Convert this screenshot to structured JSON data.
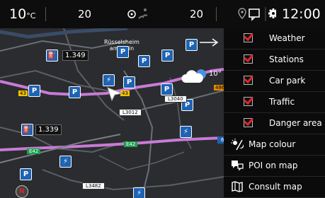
{
  "status": {
    "temperature": "10",
    "temp_unit": "°C",
    "left_value": "20",
    "right_value": "20",
    "clock": "12:00"
  },
  "map": {
    "city_line1": "Rüsselsheim",
    "city_line2": "am Main",
    "price1": "1.349",
    "price2": "1.339",
    "weather_temp": "10°",
    "roads": {
      "l3012": "L3012",
      "l3040": "L3040",
      "l3482": "L3482",
      "r43a": "43",
      "r43b": "43",
      "r486": "486",
      "e42a": "E42",
      "e42b": "E42",
      "r6": "6"
    },
    "compass": "N"
  },
  "menu": {
    "checkboxes": [
      {
        "label": "Weather",
        "checked": true
      },
      {
        "label": "Stations",
        "checked": true
      },
      {
        "label": "Car park",
        "checked": true
      },
      {
        "label": "Traffic",
        "checked": true
      },
      {
        "label": "Danger area",
        "checked": true
      }
    ],
    "actions": [
      {
        "label": "Map colour",
        "icon": "day-night-icon"
      },
      {
        "label": "POI on map",
        "icon": "poi-icon"
      },
      {
        "label": "Consult map",
        "icon": "map-icon"
      }
    ]
  },
  "colors": {
    "check_red": "#e2232a",
    "route_purple": "#c87bd6",
    "poi_blue": "#1f63b3",
    "road_green": "#19a14c",
    "road_yellow": "#f2c200"
  }
}
